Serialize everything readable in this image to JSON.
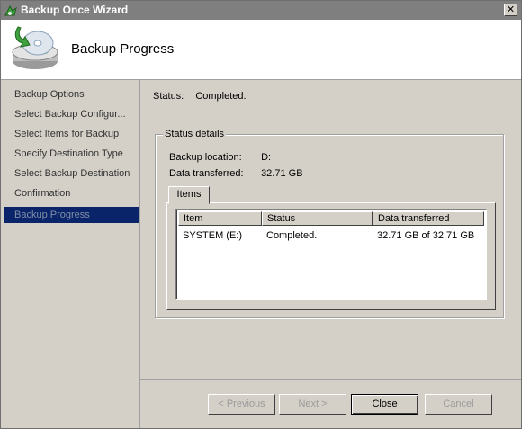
{
  "window": {
    "title": "Backup Once Wizard",
    "close_glyph": "✕"
  },
  "header": {
    "title": "Backup Progress",
    "icon": "backup-disc-icon"
  },
  "sidebar": {
    "items": [
      {
        "label": "Backup Options"
      },
      {
        "label": "Select Backup Configur..."
      },
      {
        "label": "Select Items for Backup"
      },
      {
        "label": "Specify Destination Type"
      },
      {
        "label": "Select Backup Destination"
      },
      {
        "label": "Confirmation"
      },
      {
        "label": "Backup Progress",
        "active": true
      }
    ]
  },
  "status": {
    "label": "Status:",
    "value": "Completed."
  },
  "details": {
    "legend": "Status details",
    "location_label": "Backup location:",
    "location_value": "D:",
    "transferred_label": "Data transferred:",
    "transferred_value": "32.71 GB"
  },
  "tab": {
    "label": "Items"
  },
  "table": {
    "columns": [
      "Item",
      "Status",
      "Data transferred"
    ],
    "rows": [
      [
        "SYSTEM (E:)",
        "Completed.",
        "32.71 GB of 32.71 GB"
      ]
    ]
  },
  "buttons": {
    "previous": "< Previous",
    "next": "Next >",
    "close": "Close",
    "cancel": "Cancel"
  },
  "colors": {
    "titlebar": "#7f7f7f",
    "selection": "#0a246a",
    "face": "#d4d0c8"
  }
}
